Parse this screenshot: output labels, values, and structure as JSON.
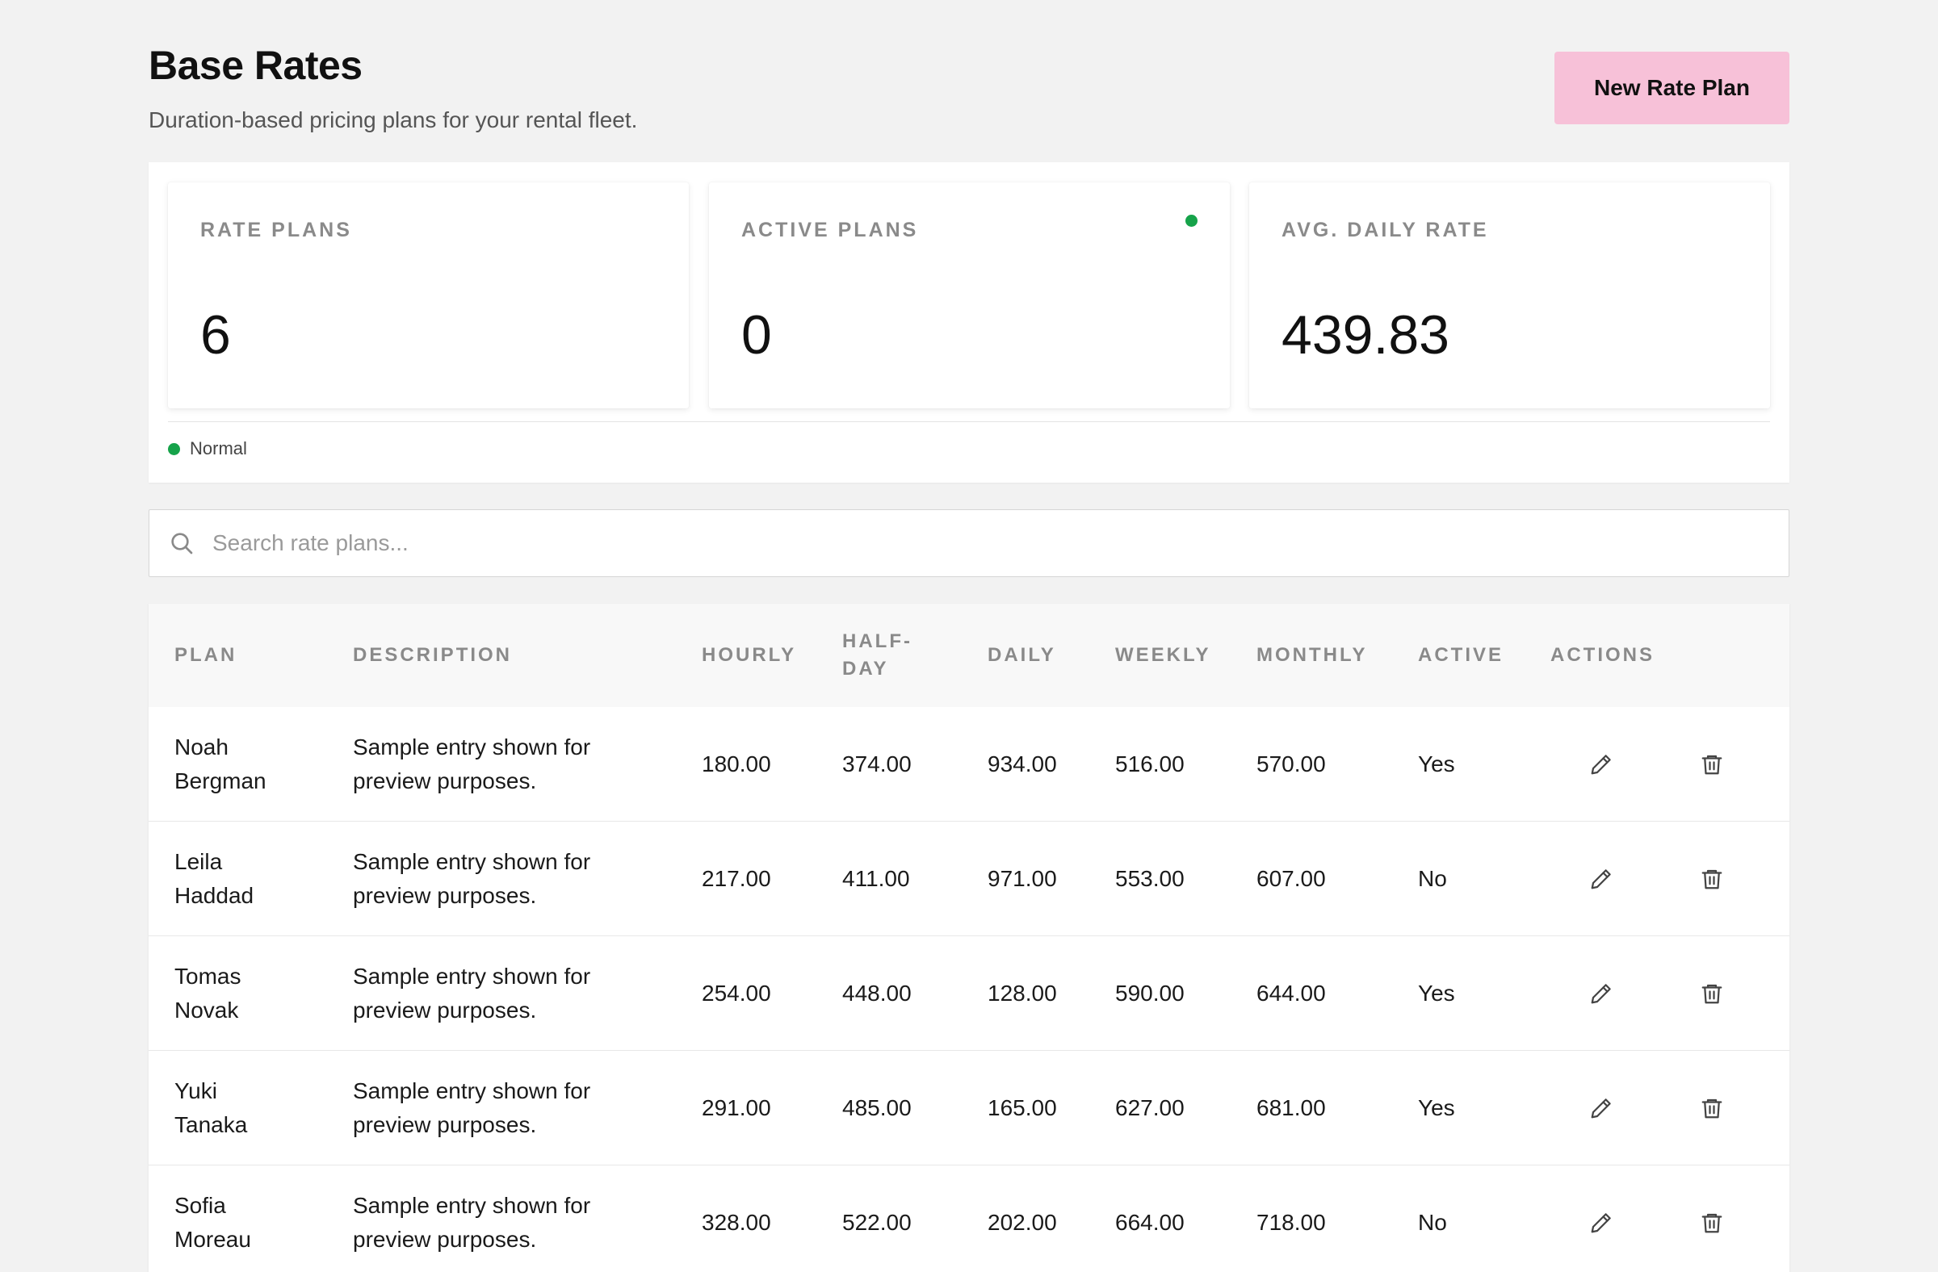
{
  "header": {
    "title": "Base Rates",
    "subtitle": "Duration-based pricing plans for your rental fleet.",
    "new_button_label": "New Rate Plan"
  },
  "stats": [
    {
      "label": "RATE PLANS",
      "value": "6"
    },
    {
      "label": "ACTIVE PLANS",
      "value": "0",
      "indicator": "#16a34a"
    },
    {
      "label": "AVG. DAILY RATE",
      "value": "439.83"
    }
  ],
  "legend": {
    "label": "Normal",
    "color": "#16a34a"
  },
  "search": {
    "placeholder": "Search rate plans...",
    "value": ""
  },
  "table": {
    "headers": {
      "plan": "PLAN",
      "description": "DESCRIPTION",
      "hourly": "HOURLY",
      "half_day_1": "HALF-",
      "half_day_2": "DAY",
      "daily": "DAILY",
      "weekly": "WEEKLY",
      "monthly": "MONTHLY",
      "active": "ACTIVE",
      "actions": "ACTIONS"
    },
    "rows": [
      {
        "first": "Noah",
        "last": "Bergman",
        "desc1": "Sample entry shown for",
        "desc2": "preview purposes.",
        "hourly": "180.00",
        "half_day": "374.00",
        "daily": "934.00",
        "weekly": "516.00",
        "monthly": "570.00",
        "active": "Yes"
      },
      {
        "first": "Leila",
        "last": "Haddad",
        "desc1": "Sample entry shown for",
        "desc2": "preview purposes.",
        "hourly": "217.00",
        "half_day": "411.00",
        "daily": "971.00",
        "weekly": "553.00",
        "monthly": "607.00",
        "active": "No"
      },
      {
        "first": "Tomas",
        "last": "Novak",
        "desc1": "Sample entry shown for",
        "desc2": "preview purposes.",
        "hourly": "254.00",
        "half_day": "448.00",
        "daily": "128.00",
        "weekly": "590.00",
        "monthly": "644.00",
        "active": "Yes"
      },
      {
        "first": "Yuki",
        "last": "Tanaka",
        "desc1": "Sample entry shown for",
        "desc2": "preview purposes.",
        "hourly": "291.00",
        "half_day": "485.00",
        "daily": "165.00",
        "weekly": "627.00",
        "monthly": "681.00",
        "active": "Yes"
      },
      {
        "first": "Sofia",
        "last": "Moreau",
        "desc1": "Sample entry shown for",
        "desc2": "preview purposes.",
        "hourly": "328.00",
        "half_day": "522.00",
        "daily": "202.00",
        "weekly": "664.00",
        "monthly": "718.00",
        "active": "No"
      }
    ]
  },
  "icons": {
    "search": "search-icon",
    "edit": "pencil-icon",
    "delete": "trash-icon"
  }
}
